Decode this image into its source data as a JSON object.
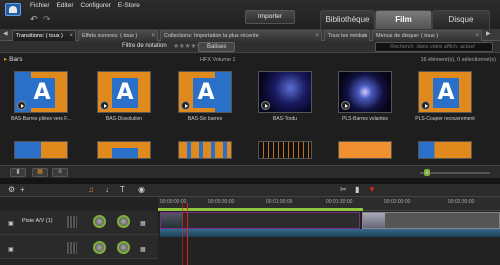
{
  "menu": [
    "Fichier",
    "Editer",
    "Configurer",
    "E-Store"
  ],
  "header": {
    "import_label": "Importer",
    "tabs": [
      "Bibliothèque",
      "Film",
      "Disque"
    ],
    "active_tab": "Film"
  },
  "library_tabs": [
    {
      "label": "Transitions: ( tous )",
      "active": true
    },
    {
      "label": "Effets sonores: ( tous )",
      "active": false
    },
    {
      "label": "Collections: Importation la plus récente",
      "active": false
    },
    {
      "label": "Tous les médias",
      "active": false
    },
    {
      "label": "Menus de disque: ( tous )",
      "active": false
    }
  ],
  "filter": {
    "rating_label": "Filtre de notation",
    "tags_label": "Balises",
    "search_placeholder": "Recherch. dans votre affich. actuel"
  },
  "browser": {
    "group": "Bars",
    "volume": "HFX Volume 1",
    "count": "16 élément(s), 0 sélectionné(s)",
    "items": [
      {
        "caption": "BAS-Barres pliées vers F..."
      },
      {
        "caption": "BAS-Dissolution"
      },
      {
        "caption": "BAS-Six barres"
      },
      {
        "caption": "BAS-Tordu"
      },
      {
        "caption": "PLS-Barres volantes"
      },
      {
        "caption": "PLS-Couper recouvrement"
      }
    ]
  },
  "timeline": {
    "ruler": [
      "00:00:00:00",
      "00:00:30:00",
      "00:01:00:00",
      "00:01:30:00",
      "00:02:00:00",
      "00:02:30:00"
    ],
    "track_name": "Piste A/V (1)"
  },
  "colors": {
    "accent": "#e08a1e",
    "thumb_blue": "#2a6fc8",
    "green": "#8fc63c",
    "playhead": "#d9261c"
  }
}
